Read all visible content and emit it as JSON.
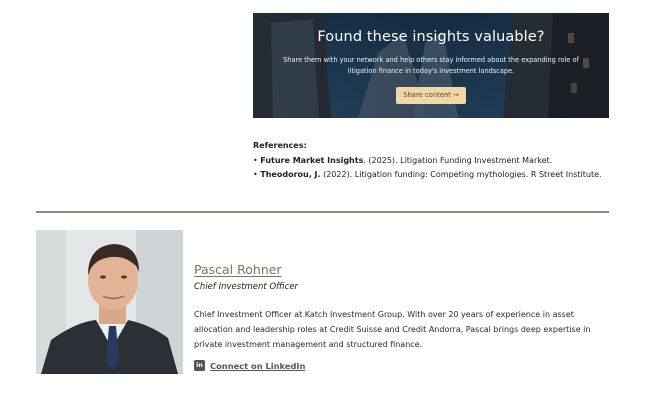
{
  "banner": {
    "title": "Found these insights valuable?",
    "text": "Share them with your network and help others stay informed about the expanding role of litigation finance in today's investment landscape.",
    "button_label": "Share content →"
  },
  "references": {
    "heading": "References:",
    "items": [
      {
        "author": "Future Market Insights",
        "rest": ". (2025). Litigation Funding Investment Market."
      },
      {
        "author": "Theodorou, J.",
        "rest": " (2022). Litigation funding: Competing mythologies. R Street Institute."
      }
    ]
  },
  "author": {
    "name": "Pascal Rohner",
    "role": "Chief Investment Officer",
    "bio": "Chief Investment Officer at Katch Investment Group. With over 20 years of experience in asset allocation and leadership roles at Credit Suisse and Credit Andorra, Pascal brings deep expertise in private investment management and structured finance.",
    "linkedin_label": "Connect on LinkedIn",
    "linkedin_icon": "linkedin-icon"
  },
  "colors": {
    "button": "#f1d7a8",
    "divider": "#8a8a82",
    "name_link": "#7a746a"
  }
}
